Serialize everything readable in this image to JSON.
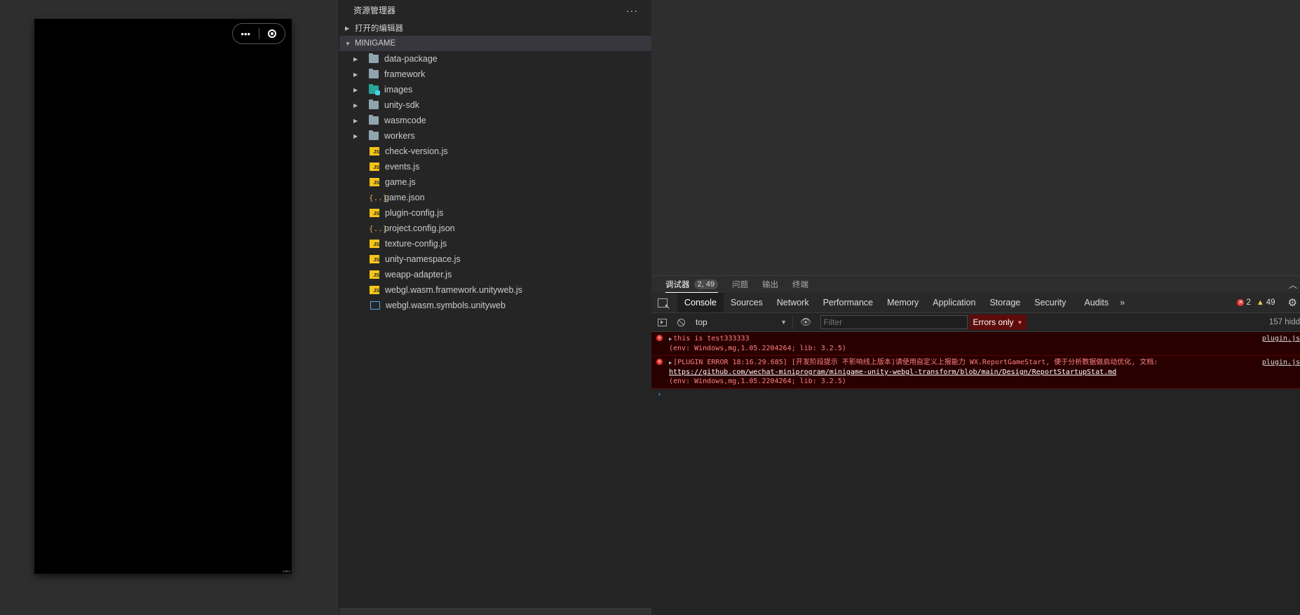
{
  "explorer": {
    "title": "资源管理器",
    "more_icon": "ellipsis-icon",
    "open_editors_label": "打开的编辑器",
    "project_label": "MINIGAME",
    "items": [
      {
        "name": "data-package",
        "type": "folder"
      },
      {
        "name": "framework",
        "type": "folder"
      },
      {
        "name": "images",
        "type": "image-folder"
      },
      {
        "name": "unity-sdk",
        "type": "folder"
      },
      {
        "name": "wasmcode",
        "type": "folder"
      },
      {
        "name": "workers",
        "type": "folder"
      },
      {
        "name": "check-version.js",
        "type": "js"
      },
      {
        "name": "events.js",
        "type": "js"
      },
      {
        "name": "game.js",
        "type": "js"
      },
      {
        "name": "game.json",
        "type": "json"
      },
      {
        "name": "plugin-config.js",
        "type": "js"
      },
      {
        "name": "project.config.json",
        "type": "json"
      },
      {
        "name": "texture-config.js",
        "type": "js"
      },
      {
        "name": "unity-namespace.js",
        "type": "js"
      },
      {
        "name": "weapp-adapter.js",
        "type": "js"
      },
      {
        "name": "webgl.wasm.framework.unityweb.js",
        "type": "js"
      },
      {
        "name": "webgl.wasm.symbols.unityweb",
        "type": "file"
      }
    ]
  },
  "simulator": {
    "capsule_menu": "•••",
    "corner_text": "1.05.2"
  },
  "panel": {
    "tabs": [
      {
        "label": "调试器",
        "count": "2, 49",
        "active": true
      },
      {
        "label": "问题"
      },
      {
        "label": "输出"
      },
      {
        "label": "终端"
      }
    ]
  },
  "devtools": {
    "tabs": [
      "Console",
      "Sources",
      "Network",
      "Performance",
      "Memory",
      "Application",
      "Storage",
      "Security",
      "Audits"
    ],
    "active_tab": "Console",
    "more_tabs": "»",
    "error_count": "2",
    "warning_count": "49",
    "context": "top",
    "filter_placeholder": "Filter",
    "levels": "Errors only",
    "hidden_count": "157 hidd"
  },
  "console": {
    "messages": [
      {
        "line1": "this is  test333333",
        "line2": "(env: Windows,mg,1.05.2204264; lib: 3.2.5)",
        "source": "plugin.js"
      },
      {
        "line1": "[PLUGIN ERROR 18:16.29.685]  [开发阶段提示 不影响线上版本]请使用自定义上报能力 WX.ReportGameStart, 便于分析数据做启动优化, 文档:",
        "link": "https://github.com/wechat-miniprogram/minigame-unity-webgl-transform/blob/main/Design/ReportStartupStat.md",
        "line3": "(env: Windows,mg,1.05.2204264; lib: 3.2.5)",
        "source": "plugin.js"
      }
    ],
    "prompt": "›"
  }
}
